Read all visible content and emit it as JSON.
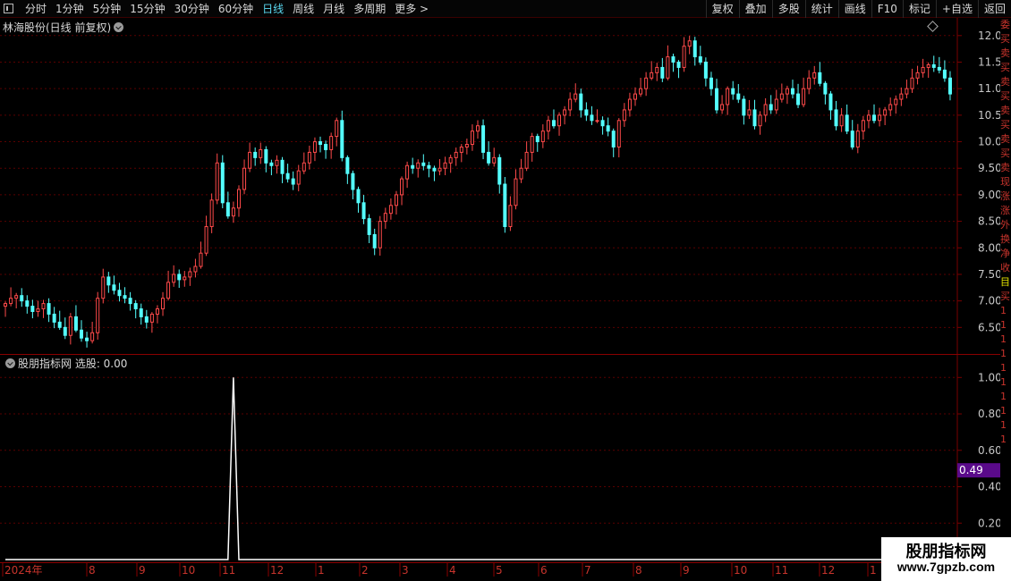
{
  "toolbar": {
    "periods": [
      {
        "label": "分时",
        "active": false
      },
      {
        "label": "1分钟",
        "active": false
      },
      {
        "label": "5分钟",
        "active": false
      },
      {
        "label": "15分钟",
        "active": false
      },
      {
        "label": "30分钟",
        "active": false
      },
      {
        "label": "60分钟",
        "active": false
      },
      {
        "label": "日线",
        "active": true
      },
      {
        "label": "周线",
        "active": false
      },
      {
        "label": "月线",
        "active": false
      },
      {
        "label": "多周期",
        "active": false
      },
      {
        "label": "更多 >",
        "active": false
      }
    ],
    "actions": [
      "复权",
      "叠加",
      "多股",
      "统计",
      "画线",
      "F10",
      "标记",
      "+自选",
      "返回"
    ]
  },
  "price_panel": {
    "title": "林海股份(日线 前复权)"
  },
  "indicator_panel": {
    "title": "股朋指标网 选股: 0.00"
  },
  "side_column_chars": [
    "委",
    "买",
    "卖",
    "买",
    "卖",
    "买",
    "卖",
    "买",
    "卖",
    "买",
    "卖",
    "现",
    "涨",
    "涨",
    "外",
    "换",
    "净",
    "收",
    "目",
    "买",
    "1",
    "1",
    "1",
    "1",
    "1",
    "1",
    "1",
    "1",
    "1",
    "1"
  ],
  "watermark": {
    "title": "股朋指标网",
    "url": "www.7gpzb.com"
  },
  "colors": {
    "up": "#ff4a4a",
    "down": "#54ffff",
    "grid": "#5a0000",
    "axis_text": "#c8c8c8",
    "highlight": "#5a0a8a"
  },
  "chart_data": [
    {
      "type": "candlestick",
      "ylim": [
        6.0,
        12.3
      ],
      "yticks": [
        6.5,
        7.0,
        7.5,
        8.0,
        8.5,
        9.0,
        9.5,
        10.0,
        10.5,
        11.0,
        11.5,
        12.0
      ],
      "series": [
        {
          "values": [
            6.95,
            7.05,
            7.1,
            7.0,
            6.9,
            6.8,
            6.85,
            6.95,
            6.75,
            6.6,
            6.5,
            6.35,
            6.7,
            6.45,
            6.3,
            6.25,
            6.4,
            7.05,
            7.45,
            7.3,
            7.2,
            7.1,
            7.05,
            6.95,
            6.85,
            6.7,
            6.6,
            6.75,
            6.85,
            7.05,
            7.35,
            7.5,
            7.4,
            7.45,
            7.55,
            7.65,
            7.9,
            8.4,
            8.9,
            9.6,
            8.85,
            8.6,
            8.75,
            9.1,
            9.5,
            9.8,
            9.7,
            9.85,
            9.6,
            9.55,
            9.65,
            9.4,
            9.3,
            9.2,
            9.45,
            9.6,
            9.8,
            10.0,
            9.95,
            9.85,
            10.1,
            10.4,
            9.7,
            9.4,
            9.1,
            8.85,
            8.55,
            8.25,
            8.0,
            8.5,
            8.65,
            8.8,
            9.0,
            9.3,
            9.55,
            9.5,
            9.6,
            9.55,
            9.5,
            9.45,
            9.5,
            9.6,
            9.7,
            9.8,
            9.9,
            9.95,
            10.2,
            10.3,
            9.8,
            9.6,
            9.7,
            9.2,
            8.4,
            8.8,
            9.3,
            9.5,
            9.8,
            10.1,
            10.0,
            10.2,
            10.4,
            10.3,
            10.5,
            10.6,
            10.8,
            10.9,
            10.6,
            10.5,
            10.4,
            10.4,
            10.3,
            10.2,
            9.9,
            10.4,
            10.6,
            10.8,
            10.9,
            11.0,
            11.2,
            11.3,
            11.4,
            11.2,
            11.6,
            11.5,
            11.4,
            11.8,
            11.9,
            11.6,
            11.5,
            11.2,
            11.0,
            10.6,
            10.7,
            11.0,
            10.9,
            10.8,
            10.5,
            10.6,
            10.3,
            10.5,
            10.7,
            10.6,
            10.8,
            10.9,
            11.0,
            10.9,
            10.7,
            11.0,
            11.2,
            11.3,
            11.1,
            10.9,
            10.6,
            10.3,
            10.5,
            10.2,
            9.9,
            10.2,
            10.4,
            10.5,
            10.4,
            10.5,
            10.6,
            10.7,
            10.8,
            10.9,
            11.0,
            11.2,
            11.3,
            11.4,
            11.45,
            11.4,
            11.35,
            11.2,
            10.9
          ]
        },
        {
          "name": "",
          "values": []
        }
      ],
      "last_close": 10.9
    },
    {
      "type": "line",
      "ylim": [
        0.0,
        1.08
      ],
      "yticks": [
        0.2,
        0.4,
        0.6,
        0.8,
        1.0
      ],
      "series": [
        {
          "name": "选股",
          "values": [
            0.0,
            0.0,
            0.0,
            1.0,
            0.0,
            0.0
          ],
          "x": [
            0,
            40,
            41,
            42,
            43,
            185
          ]
        }
      ],
      "current_value_label": "0.49"
    }
  ],
  "date_axis": [
    "2024年",
    "8",
    "9",
    "10",
    "11",
    "12",
    "1",
    "2",
    "3",
    "4",
    "5",
    "6",
    "7",
    "8",
    "9",
    "10",
    "11",
    "12",
    "1"
  ]
}
